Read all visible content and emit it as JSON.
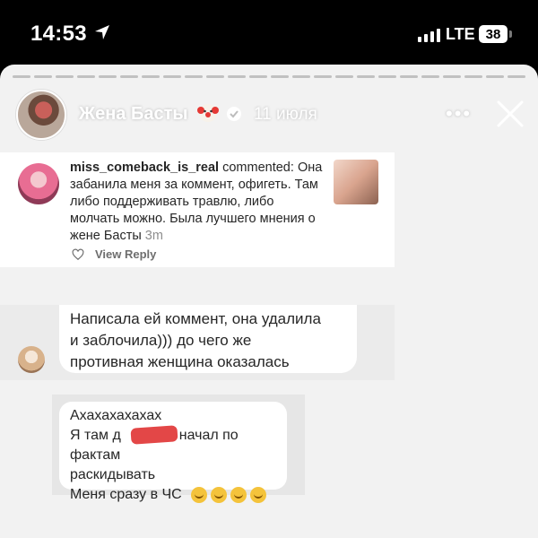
{
  "status_bar": {
    "time": "14:53",
    "network": "LTE",
    "battery": "38",
    "icons": [
      "location-arrow-icon",
      "signal-bars-icon",
      "battery-icon"
    ]
  },
  "story": {
    "author": "Жена Басты",
    "date": "11 июля",
    "more": "•••",
    "icons": [
      "clown-emoji-icon",
      "verified-badge-icon",
      "close-icon",
      "more-dots-icon"
    ]
  },
  "comment": {
    "username": "miss_comeback_is_real",
    "action": "commented:",
    "text": "Она забанила меня за коммент, офигеть. Там либо поддерживать травлю, либо молчать можно. Была лучшего мнения о жене Басты",
    "time": "3m",
    "view_reply": "View Reply",
    "icons": [
      "heart-icon"
    ]
  },
  "messages": [
    {
      "lines": [
        "Написала ей коммент, она удалила",
        "и заблочила))) до чего же",
        "противная женщина оказалась"
      ]
    },
    {
      "lines": [
        "Ахахахахахах",
        "Я там д",
        "начал по фактам",
        "раскидывать",
        "Меня сразу в ЧС"
      ],
      "emoji_count": 4
    }
  ],
  "colors": {
    "background": "#000000",
    "story_bg": "#f2f2f2",
    "bubble_bg": "#ffffff",
    "redaction": "#e23d3d"
  }
}
